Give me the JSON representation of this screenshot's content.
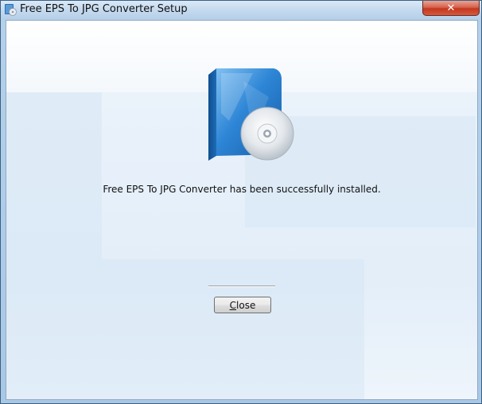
{
  "window": {
    "title": "Free EPS To JPG Converter Setup",
    "close_glyph": "✕"
  },
  "main": {
    "message": "Free EPS To JPG Converter has been successfully installed.",
    "close_button": {
      "mnemonic": "C",
      "rest": "lose"
    }
  },
  "colors": {
    "titlebar": "#c3d9ee",
    "close_red": "#c4371f",
    "client_bg": "#f2f7fc",
    "box_blue": "#1d6fbf"
  },
  "icons": {
    "app": "setup-app-icon",
    "product": "software-box-cd-icon"
  }
}
